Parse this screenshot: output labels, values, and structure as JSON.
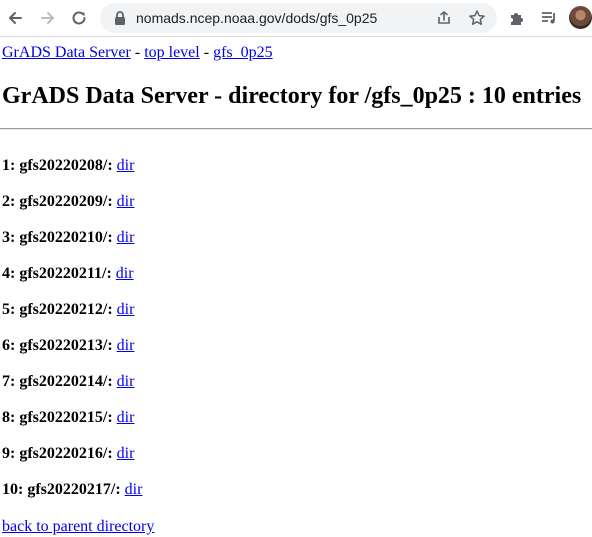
{
  "browser": {
    "url": "nomads.ncep.noaa.gov/dods/gfs_0p25"
  },
  "page": {
    "breadcrumb": {
      "link1": "GrADS Data Server",
      "sep1": " - ",
      "link2": "top level",
      "sep2": " - ",
      "link3": "gfs_0p25"
    },
    "title": "GrADS Data Server - directory for /gfs_0p25 : 10 entries",
    "entries": [
      {
        "label": "1: gfs20220208/:",
        "link": "dir"
      },
      {
        "label": "2: gfs20220209/:",
        "link": "dir"
      },
      {
        "label": "3: gfs20220210/:",
        "link": "dir"
      },
      {
        "label": "4: gfs20220211/:",
        "link": "dir"
      },
      {
        "label": "5: gfs20220212/:",
        "link": "dir"
      },
      {
        "label": "6: gfs20220213/:",
        "link": "dir"
      },
      {
        "label": "7: gfs20220214/:",
        "link": "dir"
      },
      {
        "label": "8: gfs20220215/:",
        "link": "dir"
      },
      {
        "label": "9: gfs20220216/:",
        "link": "dir"
      },
      {
        "label": "10: gfs20220217/:",
        "link": "dir"
      }
    ],
    "back_link": "back to parent directory"
  }
}
